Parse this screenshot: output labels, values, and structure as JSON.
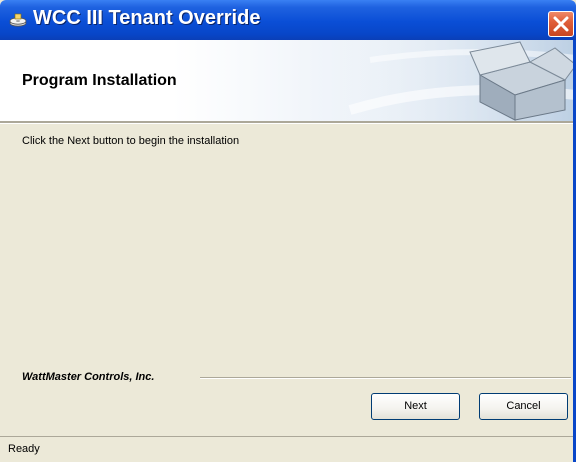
{
  "window": {
    "title": "WCC III Tenant Override",
    "icon": "installer-disk-icon",
    "close_icon": "close-icon"
  },
  "header": {
    "title": "Program Installation",
    "graphic": "open-box-graphic"
  },
  "main": {
    "instruction": "Click the Next button to begin the installation",
    "brand": "WattMaster Controls, Inc."
  },
  "buttons": {
    "next": "Next",
    "cancel": "Cancel"
  },
  "status": {
    "text": "Ready"
  },
  "colors": {
    "titlebar": "#0a4ed6",
    "close": "#e05f3a",
    "dialog_bg": "#ece9d8"
  }
}
